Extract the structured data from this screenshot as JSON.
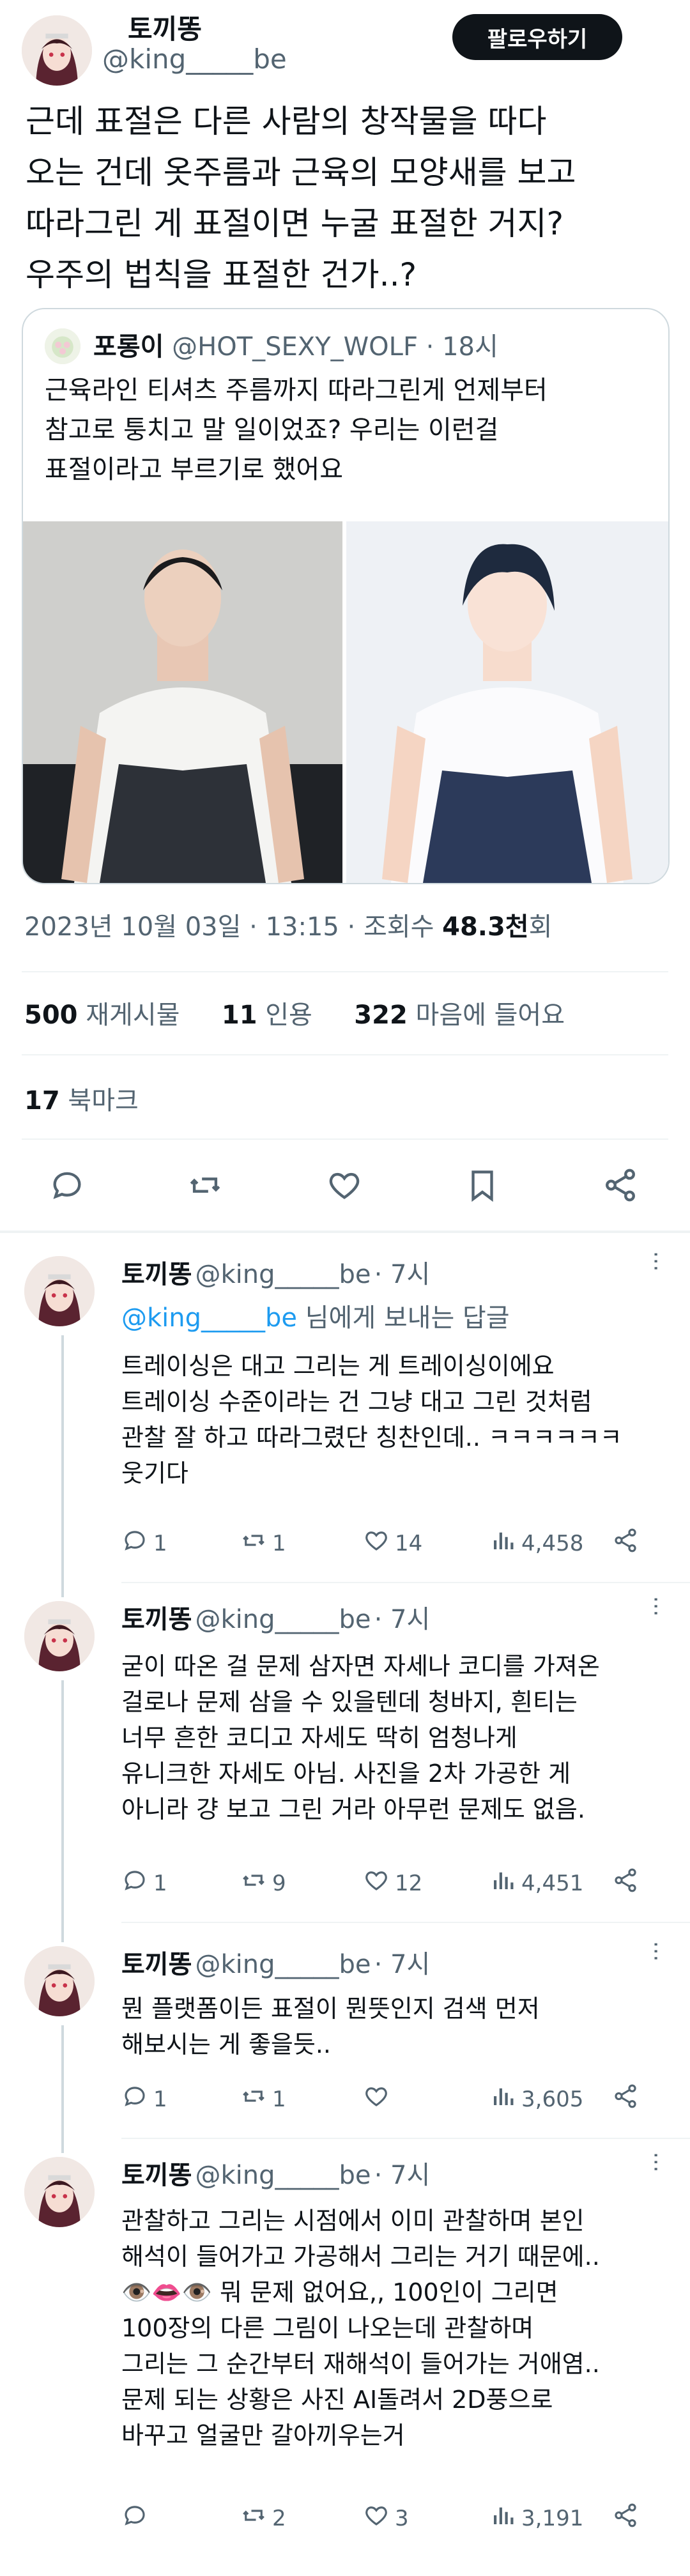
{
  "tweet": {
    "author_name": "토끼똥",
    "author_handle": "@king_____be",
    "follow_label": "팔로우하기",
    "text": "근데 표절은 다른 사람의 창작물을 따다\n오는 건데 옷주름과 근육의 모양새를 보고\n따라그린 게 표절이면 누굴 표절한 거지?\n우주의 법칙을  표절한 건가..?",
    "timestamp": "2023년 10월 03일 · 13:15 · 조회수 ",
    "views_num": "48.3천",
    "views_suffix": "회",
    "stats": {
      "retweets": "500",
      "retweets_label": "재게시물",
      "quotes": "11",
      "quotes_label": "인용",
      "likes": "322",
      "likes_label": "마음에 들어요",
      "bookmarks": "17",
      "bookmarks_label": "북마크"
    }
  },
  "quote": {
    "author_name": "포롱이",
    "author_handle": "@HOT_SEXY_WOLF",
    "time": "· 18시",
    "text": "근육라인 티셔츠 주름까지 따라그린게 언제부터\n참고로 퉁치고 말 일이었죠? 우리는 이런걸\n표절이라고 부르기로 했어요"
  },
  "replies": [
    {
      "name": "토끼똥",
      "handle": "@king_____be",
      "time": "· 7시",
      "reply_to_handle": "@king_____be",
      "reply_to_suffix": " 님에게 보내는 답글",
      "text": "트레이싱은 대고 그리는 게 트레이싱이에요\n트레이싱 수준이라는 건 그냥 대고 그린 것처럼\n관찰 잘 하고 따라그렸단 칭찬인데.. ㅋㅋㅋㅋㅋㅋ\n웃기다",
      "replies": "1",
      "retweets": "1",
      "likes": "14",
      "views": "4,458"
    },
    {
      "name": "토끼똥",
      "handle": "@king_____be",
      "time": "· 7시",
      "text": "굳이 따온 걸 문제 삼자면 자세나 코디를 가져온\n걸로나 문제 삼을 수 있을텐데 청바지, 흰티는\n너무 흔한 코디고 자세도 딱히 엄청나게\n유니크한 자세도 아님. 사진을 2차 가공한 게\n아니라 걍 보고 그린 거라 아무런 문제도 없음.",
      "replies": "1",
      "retweets": "9",
      "likes": "12",
      "views": "4,451"
    },
    {
      "name": "토끼똥",
      "handle": "@king_____be",
      "time": "· 7시",
      "text": "뭔 플랫폼이든 표절이 뭔뜻인지 검색 먼저\n해보시는 게 좋을듯..",
      "replies": "1",
      "retweets": "1",
      "likes": "",
      "views": "3,605"
    },
    {
      "name": "토끼똥",
      "handle": "@king_____be",
      "time": "· 7시",
      "text": "관찰하고 그리는 시점에서 이미 관찰하며 본인\n해석이 들어가고 가공해서 그리는 거기 때문에..\n👁️👄👁️ 뭐 문제 없어요,, 100인이 그리면\n100장의 다른 그림이 나오는데 관찰하며\n그리는 그 순간부터 재해석이 들어가는 거애염..\n문제 되는 상황은 사진 AI돌려서 2D풍으로\n바꾸고 얼굴만 갈아끼우는거",
      "replies": "",
      "retweets": "2",
      "likes": "3",
      "views": "3,191"
    }
  ],
  "colors": {
    "accent": "#1d9bf0",
    "text": "#0f1419",
    "muted": "#536471",
    "border": "#cfd9de"
  }
}
